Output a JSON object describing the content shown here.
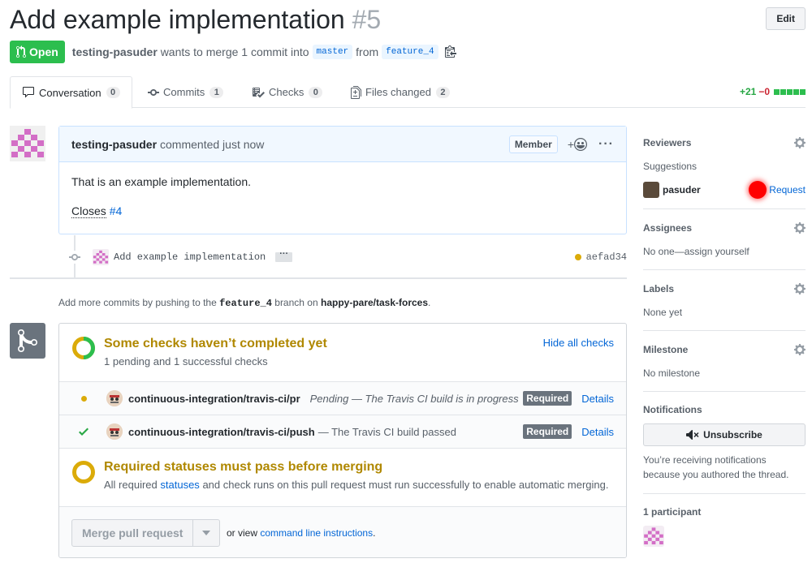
{
  "header": {
    "title": "Add example implementation",
    "number": "#5",
    "edit_label": "Edit"
  },
  "meta": {
    "state": "Open",
    "author": "testing-pasuder",
    "action_text": "wants to merge 1 commit into",
    "base_branch": "master",
    "from_text": "from",
    "head_branch": "feature_4"
  },
  "tabs": [
    {
      "label": "Conversation",
      "count": "0"
    },
    {
      "label": "Commits",
      "count": "1"
    },
    {
      "label": "Checks",
      "count": "0"
    },
    {
      "label": "Files changed",
      "count": "2"
    }
  ],
  "diffstat": {
    "additions": "+21",
    "deletions": "−0"
  },
  "comment": {
    "author": "testing-pasuder",
    "action": "commented just now",
    "badge": "Member",
    "body": "That is an example implementation.",
    "closes_word": "Closes",
    "closes_ref": "#4"
  },
  "commit": {
    "message": "Add example implementation",
    "ellipsis": "···",
    "sha": "aefad34"
  },
  "push_hint": {
    "prefix": "Add more commits by pushing to the",
    "branch": "feature_4",
    "middle": "branch on",
    "repo": "happy-pare/task-forces",
    "suffix": "."
  },
  "checks": {
    "title": "Some checks haven’t completed yet",
    "subtitle": "1 pending and 1 successful checks",
    "hide_label": "Hide all checks",
    "rows": [
      {
        "name": "continuous-integration/travis-ci/pr",
        "desc": "Pending — The Travis CI build is in progress",
        "badge": "Required",
        "details": "Details"
      },
      {
        "name": "continuous-integration/travis-ci/push",
        "desc": "— The Travis CI build passed",
        "badge": "Required",
        "details": "Details"
      }
    ]
  },
  "required": {
    "title": "Required statuses must pass before merging",
    "sub_prefix": "All required",
    "sub_link": "statuses",
    "sub_suffix": "and check runs on this pull request must run successfully to enable automatic merging."
  },
  "merge": {
    "button_label": "Merge pull request",
    "alt_prefix": "or view",
    "alt_link": "command line instructions",
    "alt_suffix": "."
  },
  "sidebar": {
    "reviewers": {
      "title": "Reviewers",
      "suggestions": "Suggestions",
      "reviewer": "pasuder",
      "request": "Request"
    },
    "assignees": {
      "title": "Assignees",
      "text": "No one—assign yourself"
    },
    "labels": {
      "title": "Labels",
      "text": "None yet"
    },
    "milestone": {
      "title": "Milestone",
      "text": "No milestone"
    },
    "notifications": {
      "title": "Notifications",
      "button": "Unsubscribe",
      "text": "You’re receiving notifications because you authored the thread."
    },
    "participants": {
      "title": "1 participant"
    }
  },
  "colors": {
    "open_green": "#2cbe4e",
    "pending_yellow": "#b08800",
    "link_blue": "#0366d6",
    "request_dot": "#ff0000"
  }
}
